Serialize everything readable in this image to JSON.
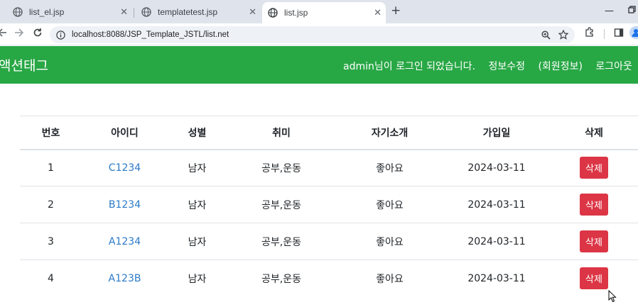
{
  "browser": {
    "tabs": [
      {
        "title": "list_el.jsp"
      },
      {
        "title": "templatetest.jsp"
      },
      {
        "title": "list.jsp"
      }
    ],
    "url": "localhost:8088/JSP_Template_JSTL/list.net"
  },
  "navbar": {
    "brand": "액션태그",
    "welcome": "admin님이 로그인 되었습니다.",
    "edit_info": "정보수정",
    "member_info": "(회원정보)",
    "logout": "로그아웃"
  },
  "table": {
    "headers": [
      "번호",
      "아이디",
      "성별",
      "취미",
      "자기소개",
      "가입일",
      "삭제"
    ],
    "rows": [
      {
        "no": "1",
        "id": "C1234",
        "gender": "남자",
        "hobby": "공부,운동",
        "intro": "좋아요",
        "joined": "2024-03-11",
        "delete": "삭제"
      },
      {
        "no": "2",
        "id": "B1234",
        "gender": "남자",
        "hobby": "공부,운동",
        "intro": "좋아요",
        "joined": "2024-03-11",
        "delete": "삭제"
      },
      {
        "no": "3",
        "id": "A1234",
        "gender": "남자",
        "hobby": "공부,운동",
        "intro": "좋아요",
        "joined": "2024-03-11",
        "delete": "삭제"
      },
      {
        "no": "4",
        "id": "A123B",
        "gender": "남자",
        "hobby": "공부,운동",
        "intro": "좋아요",
        "joined": "2024-03-11",
        "delete": "삭제"
      }
    ]
  },
  "colors": {
    "navbar": "#28a745",
    "delete_button": "#dc3545",
    "link": "#2b7ac8"
  }
}
